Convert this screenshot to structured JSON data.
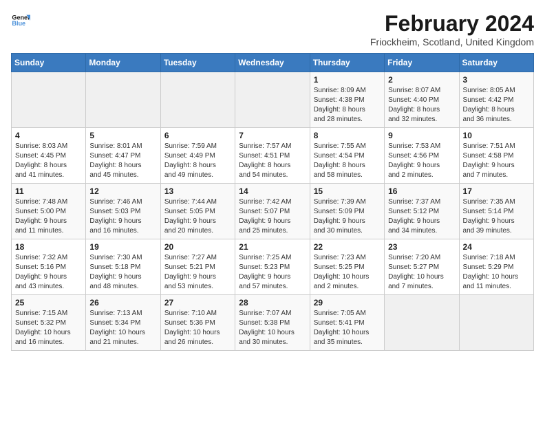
{
  "logo": {
    "line1": "General",
    "line2": "Blue"
  },
  "title": "February 2024",
  "subtitle": "Friockheim, Scotland, United Kingdom",
  "days_of_week": [
    "Sunday",
    "Monday",
    "Tuesday",
    "Wednesday",
    "Thursday",
    "Friday",
    "Saturday"
  ],
  "weeks": [
    [
      {
        "day": "",
        "info": ""
      },
      {
        "day": "",
        "info": ""
      },
      {
        "day": "",
        "info": ""
      },
      {
        "day": "",
        "info": ""
      },
      {
        "day": "1",
        "info": "Sunrise: 8:09 AM\nSunset: 4:38 PM\nDaylight: 8 hours\nand 28 minutes."
      },
      {
        "day": "2",
        "info": "Sunrise: 8:07 AM\nSunset: 4:40 PM\nDaylight: 8 hours\nand 32 minutes."
      },
      {
        "day": "3",
        "info": "Sunrise: 8:05 AM\nSunset: 4:42 PM\nDaylight: 8 hours\nand 36 minutes."
      }
    ],
    [
      {
        "day": "4",
        "info": "Sunrise: 8:03 AM\nSunset: 4:45 PM\nDaylight: 8 hours\nand 41 minutes."
      },
      {
        "day": "5",
        "info": "Sunrise: 8:01 AM\nSunset: 4:47 PM\nDaylight: 8 hours\nand 45 minutes."
      },
      {
        "day": "6",
        "info": "Sunrise: 7:59 AM\nSunset: 4:49 PM\nDaylight: 8 hours\nand 49 minutes."
      },
      {
        "day": "7",
        "info": "Sunrise: 7:57 AM\nSunset: 4:51 PM\nDaylight: 8 hours\nand 54 minutes."
      },
      {
        "day": "8",
        "info": "Sunrise: 7:55 AM\nSunset: 4:54 PM\nDaylight: 8 hours\nand 58 minutes."
      },
      {
        "day": "9",
        "info": "Sunrise: 7:53 AM\nSunset: 4:56 PM\nDaylight: 9 hours\nand 2 minutes."
      },
      {
        "day": "10",
        "info": "Sunrise: 7:51 AM\nSunset: 4:58 PM\nDaylight: 9 hours\nand 7 minutes."
      }
    ],
    [
      {
        "day": "11",
        "info": "Sunrise: 7:48 AM\nSunset: 5:00 PM\nDaylight: 9 hours\nand 11 minutes."
      },
      {
        "day": "12",
        "info": "Sunrise: 7:46 AM\nSunset: 5:03 PM\nDaylight: 9 hours\nand 16 minutes."
      },
      {
        "day": "13",
        "info": "Sunrise: 7:44 AM\nSunset: 5:05 PM\nDaylight: 9 hours\nand 20 minutes."
      },
      {
        "day": "14",
        "info": "Sunrise: 7:42 AM\nSunset: 5:07 PM\nDaylight: 9 hours\nand 25 minutes."
      },
      {
        "day": "15",
        "info": "Sunrise: 7:39 AM\nSunset: 5:09 PM\nDaylight: 9 hours\nand 30 minutes."
      },
      {
        "day": "16",
        "info": "Sunrise: 7:37 AM\nSunset: 5:12 PM\nDaylight: 9 hours\nand 34 minutes."
      },
      {
        "day": "17",
        "info": "Sunrise: 7:35 AM\nSunset: 5:14 PM\nDaylight: 9 hours\nand 39 minutes."
      }
    ],
    [
      {
        "day": "18",
        "info": "Sunrise: 7:32 AM\nSunset: 5:16 PM\nDaylight: 9 hours\nand 43 minutes."
      },
      {
        "day": "19",
        "info": "Sunrise: 7:30 AM\nSunset: 5:18 PM\nDaylight: 9 hours\nand 48 minutes."
      },
      {
        "day": "20",
        "info": "Sunrise: 7:27 AM\nSunset: 5:21 PM\nDaylight: 9 hours\nand 53 minutes."
      },
      {
        "day": "21",
        "info": "Sunrise: 7:25 AM\nSunset: 5:23 PM\nDaylight: 9 hours\nand 57 minutes."
      },
      {
        "day": "22",
        "info": "Sunrise: 7:23 AM\nSunset: 5:25 PM\nDaylight: 10 hours\nand 2 minutes."
      },
      {
        "day": "23",
        "info": "Sunrise: 7:20 AM\nSunset: 5:27 PM\nDaylight: 10 hours\nand 7 minutes."
      },
      {
        "day": "24",
        "info": "Sunrise: 7:18 AM\nSunset: 5:29 PM\nDaylight: 10 hours\nand 11 minutes."
      }
    ],
    [
      {
        "day": "25",
        "info": "Sunrise: 7:15 AM\nSunset: 5:32 PM\nDaylight: 10 hours\nand 16 minutes."
      },
      {
        "day": "26",
        "info": "Sunrise: 7:13 AM\nSunset: 5:34 PM\nDaylight: 10 hours\nand 21 minutes."
      },
      {
        "day": "27",
        "info": "Sunrise: 7:10 AM\nSunset: 5:36 PM\nDaylight: 10 hours\nand 26 minutes."
      },
      {
        "day": "28",
        "info": "Sunrise: 7:07 AM\nSunset: 5:38 PM\nDaylight: 10 hours\nand 30 minutes."
      },
      {
        "day": "29",
        "info": "Sunrise: 7:05 AM\nSunset: 5:41 PM\nDaylight: 10 hours\nand 35 minutes."
      },
      {
        "day": "",
        "info": ""
      },
      {
        "day": "",
        "info": ""
      }
    ]
  ]
}
